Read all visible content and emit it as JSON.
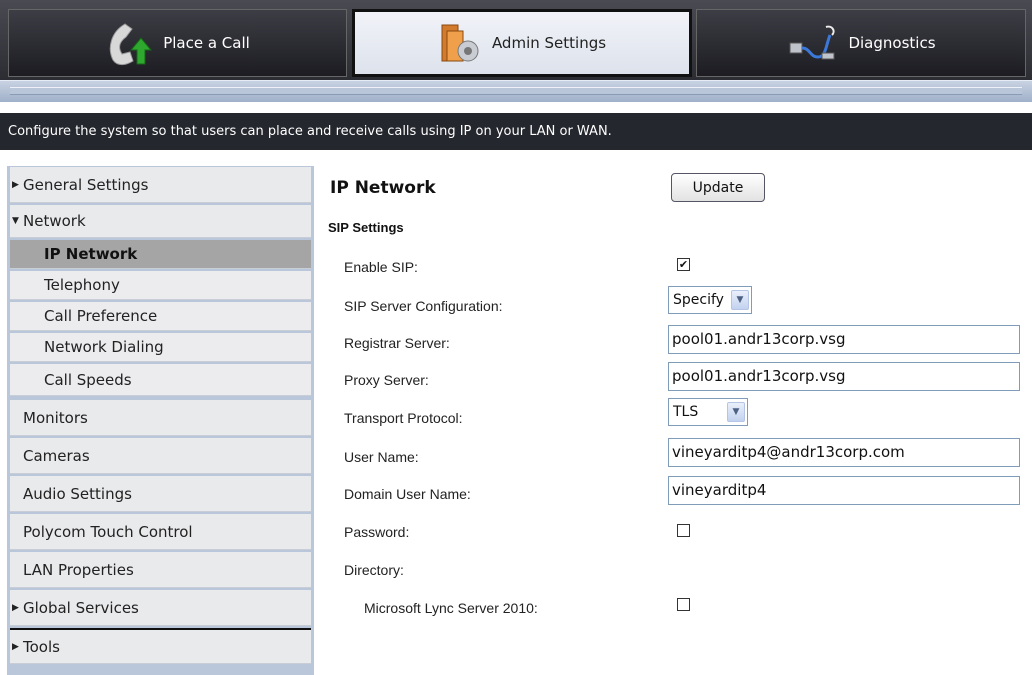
{
  "tabs": {
    "place_call": "Place a Call",
    "admin_settings": "Admin Settings",
    "diagnostics": "Diagnostics"
  },
  "description": "Configure the system so that users can place and receive calls using IP on your LAN or WAN.",
  "sidebar": {
    "general_settings": "General Settings",
    "network": "Network",
    "network_items": [
      "IP Network",
      "Telephony",
      "Call Preference",
      "Network Dialing",
      "Call Speeds"
    ],
    "monitors": "Monitors",
    "cameras": "Cameras",
    "audio_settings": "Audio Settings",
    "touch_control": "Polycom Touch Control",
    "lan_properties": "LAN Properties",
    "global_services": "Global Services",
    "tools": "Tools"
  },
  "main": {
    "title": "IP Network",
    "update_label": "Update",
    "section": "SIP Settings",
    "labels": {
      "enable_sip": "Enable SIP:",
      "sip_server_config": "SIP Server Configuration:",
      "registrar": "Registrar Server:",
      "proxy": "Proxy Server:",
      "transport": "Transport Protocol:",
      "user_name": "User Name:",
      "domain_user": "Domain User Name:",
      "password": "Password:",
      "directory": "Directory:",
      "lync": "Microsoft Lync Server 2010:"
    },
    "values": {
      "enable_sip": true,
      "sip_server_config": "Specify",
      "registrar": "pool01.andr13corp.vsg",
      "proxy": "pool01.andr13corp.vsg",
      "transport": "TLS",
      "user_name": "vineyarditp4@andr13corp.com",
      "domain_user": "vineyarditp4",
      "password": false,
      "lync": false
    },
    "check_mark": "✔"
  },
  "colors": {
    "header_dark": "#24272d",
    "sidebar_bg": "#bac7da",
    "selected_item": "#a5a5a5"
  }
}
